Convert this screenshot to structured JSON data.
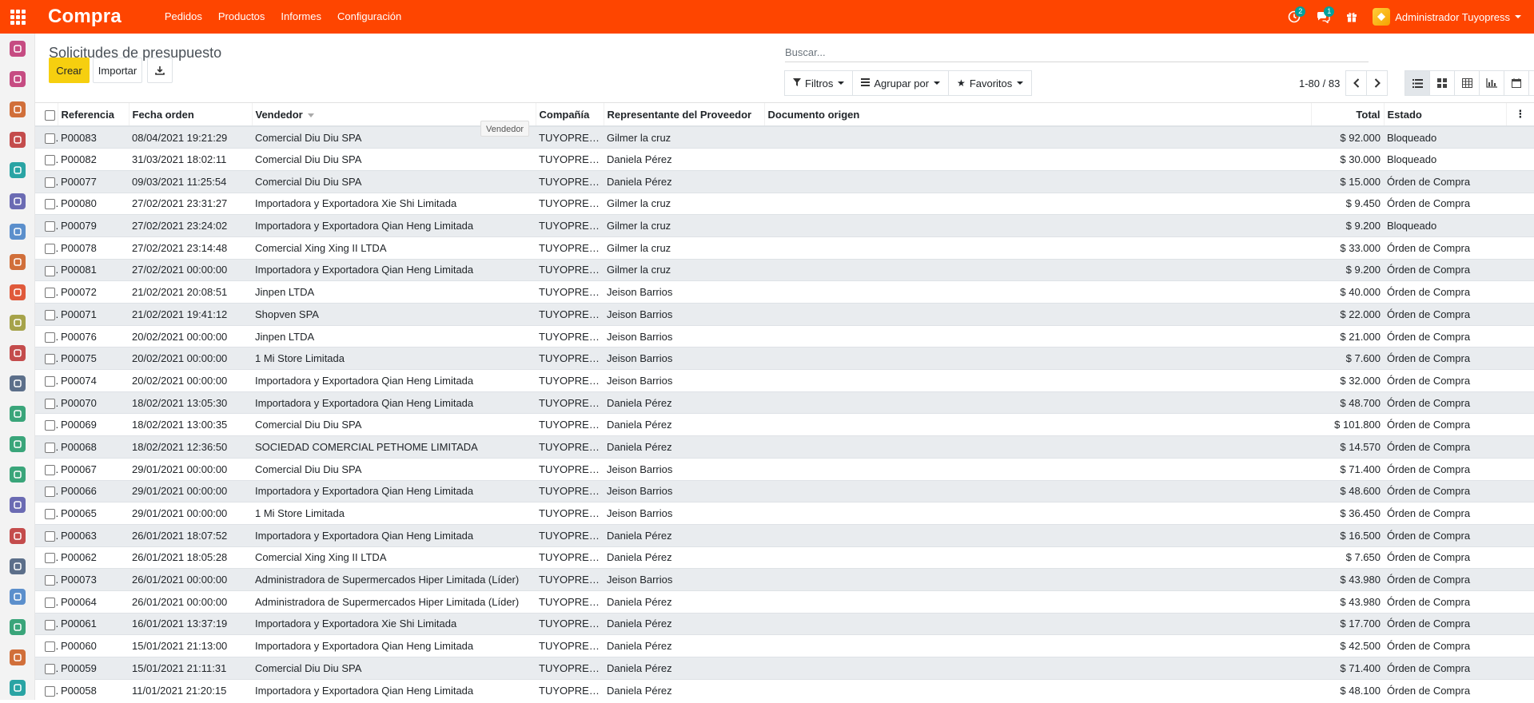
{
  "navbar": {
    "brand": "Compra",
    "menu": [
      "Pedidos",
      "Productos",
      "Informes",
      "Configuración"
    ],
    "activity_badge": "2",
    "messages_badge": "1",
    "user": "Administrador Tuyopress",
    "color": "#fe4500"
  },
  "sidebar": {
    "icons": [
      {
        "name": "discuss-icon",
        "color": "#c64c82"
      },
      {
        "name": "calendar-icon",
        "color": "#c64c82"
      },
      {
        "name": "crm-icon",
        "color": "#d16f3a"
      },
      {
        "name": "sales-icon",
        "color": "#c44c4c"
      },
      {
        "name": "contacts-icon",
        "color": "#2aa4a4"
      },
      {
        "name": "documents-icon",
        "color": "#6b6bb3"
      },
      {
        "name": "accounting-icon",
        "color": "#5b8fcc"
      },
      {
        "name": "expenses-icon",
        "color": "#d16f3a"
      },
      {
        "name": "website-icon",
        "color": "#e05a3b"
      },
      {
        "name": "events-icon",
        "color": "#a6a34a"
      },
      {
        "name": "livechat-icon",
        "color": "#c44c4c"
      },
      {
        "name": "pos-icon",
        "color": "#5c6f8a"
      },
      {
        "name": "employees-icon",
        "color": "#3aa57a"
      },
      {
        "name": "maintenance-icon",
        "color": "#3aa57a"
      },
      {
        "name": "fleet-icon",
        "color": "#3aa57a"
      },
      {
        "name": "apps-icon",
        "color": "#6b6bb3"
      },
      {
        "name": "timesheets-icon",
        "color": "#c44c4c"
      },
      {
        "name": "email-marketing-icon",
        "color": "#5c6f8a"
      },
      {
        "name": "mobile-icon",
        "color": "#5b8fcc"
      },
      {
        "name": "tags-icon",
        "color": "#3aa57a"
      },
      {
        "name": "notes-icon",
        "color": "#d16f3a"
      },
      {
        "name": "team-icon",
        "color": "#2aa4a4"
      }
    ]
  },
  "control_panel": {
    "title": "Solicitudes de presupuesto",
    "search_placeholder": "Buscar...",
    "create_label": "Crear",
    "import_label": "Importar",
    "filters_label": "Filtros",
    "groupby_label": "Agrupar por",
    "favorites_label": "Favoritos",
    "pager_value": "1-80 / 83"
  },
  "tooltip": "Vendedor",
  "table": {
    "columns": [
      "Referencia",
      "Fecha orden",
      "Vendedor",
      "Compañía",
      "Representante del Proveedor",
      "Documento origen",
      "Total",
      "Estado"
    ],
    "rows": [
      [
        "P00083",
        "08/04/2021 19:21:29",
        "Comercial Diu Diu SPA",
        "TUYOPRESS",
        "Gilmer la cruz",
        "",
        "$ 92.000",
        "Bloqueado"
      ],
      [
        "P00082",
        "31/03/2021 18:02:11",
        "Comercial Diu Diu SPA",
        "TUYOPRESS",
        "Daniela Pérez",
        "",
        "$ 30.000",
        "Bloqueado"
      ],
      [
        "P00077",
        "09/03/2021 11:25:54",
        "Comercial Diu Diu SPA",
        "TUYOPRESS",
        "Daniela Pérez",
        "",
        "$ 15.000",
        "Órden de Compra"
      ],
      [
        "P00080",
        "27/02/2021 23:31:27",
        "Importadora y Exportadora Xie Shi Limitada",
        "TUYOPRESS",
        "Gilmer la cruz",
        "",
        "$ 9.450",
        "Órden de Compra"
      ],
      [
        "P00079",
        "27/02/2021 23:24:02",
        "Importadora y Exportadora Qian Heng Limitada",
        "TUYOPRESS",
        "Gilmer la cruz",
        "",
        "$ 9.200",
        "Bloqueado"
      ],
      [
        "P00078",
        "27/02/2021 23:14:48",
        "Comercial Xing Xing II LTDA",
        "TUYOPRESS",
        "Gilmer la cruz",
        "",
        "$ 33.000",
        "Órden de Compra"
      ],
      [
        "P00081",
        "27/02/2021 00:00:00",
        "Importadora y Exportadora Qian Heng Limitada",
        "TUYOPRESS",
        "Gilmer la cruz",
        "",
        "$ 9.200",
        "Órden de Compra"
      ],
      [
        "P00072",
        "21/02/2021 20:08:51",
        "Jinpen LTDA",
        "TUYOPRESS",
        "Jeison Barrios",
        "",
        "$ 40.000",
        "Órden de Compra"
      ],
      [
        "P00071",
        "21/02/2021 19:41:12",
        "Shopven SPA",
        "TUYOPRESS",
        "Jeison Barrios",
        "",
        "$ 22.000",
        "Órden de Compra"
      ],
      [
        "P00076",
        "20/02/2021 00:00:00",
        "Jinpen LTDA",
        "TUYOPRESS",
        "Jeison Barrios",
        "",
        "$ 21.000",
        "Órden de Compra"
      ],
      [
        "P00075",
        "20/02/2021 00:00:00",
        "1 Mi Store Limitada",
        "TUYOPRESS",
        "Jeison Barrios",
        "",
        "$ 7.600",
        "Órden de Compra"
      ],
      [
        "P00074",
        "20/02/2021 00:00:00",
        "Importadora y Exportadora Qian Heng Limitada",
        "TUYOPRESS",
        "Jeison Barrios",
        "",
        "$ 32.000",
        "Órden de Compra"
      ],
      [
        "P00070",
        "18/02/2021 13:05:30",
        "Importadora y Exportadora Qian Heng Limitada",
        "TUYOPRESS",
        "Daniela Pérez",
        "",
        "$ 48.700",
        "Órden de Compra"
      ],
      [
        "P00069",
        "18/02/2021 13:00:35",
        "Comercial Diu Diu SPA",
        "TUYOPRESS",
        "Daniela Pérez",
        "",
        "$ 101.800",
        "Órden de Compra"
      ],
      [
        "P00068",
        "18/02/2021 12:36:50",
        "SOCIEDAD COMERCIAL PETHOME LIMITADA",
        "TUYOPRESS",
        "Daniela Pérez",
        "",
        "$ 14.570",
        "Órden de Compra"
      ],
      [
        "P00067",
        "29/01/2021 00:00:00",
        "Comercial Diu Diu SPA",
        "TUYOPRESS",
        "Jeison Barrios",
        "",
        "$ 71.400",
        "Órden de Compra"
      ],
      [
        "P00066",
        "29/01/2021 00:00:00",
        "Importadora y Exportadora Qian Heng Limitada",
        "TUYOPRESS",
        "Jeison Barrios",
        "",
        "$ 48.600",
        "Órden de Compra"
      ],
      [
        "P00065",
        "29/01/2021 00:00:00",
        "1 Mi Store Limitada",
        "TUYOPRESS",
        "Jeison Barrios",
        "",
        "$ 36.450",
        "Órden de Compra"
      ],
      [
        "P00063",
        "26/01/2021 18:07:52",
        "Importadora y Exportadora Qian Heng Limitada",
        "TUYOPRESS",
        "Daniela Pérez",
        "",
        "$ 16.500",
        "Órden de Compra"
      ],
      [
        "P00062",
        "26/01/2021 18:05:28",
        "Comercial Xing Xing II LTDA",
        "TUYOPRESS",
        "Daniela Pérez",
        "",
        "$ 7.650",
        "Órden de Compra"
      ],
      [
        "P00073",
        "26/01/2021 00:00:00",
        "Administradora de Supermercados Hiper Limitada (Líder)",
        "TUYOPRESS",
        "Jeison Barrios",
        "",
        "$ 43.980",
        "Órden de Compra"
      ],
      [
        "P00064",
        "26/01/2021 00:00:00",
        "Administradora de Supermercados Hiper Limitada (Líder)",
        "TUYOPRESS",
        "Daniela Pérez",
        "",
        "$ 43.980",
        "Órden de Compra"
      ],
      [
        "P00061",
        "16/01/2021 13:37:19",
        "Importadora y Exportadora Xie Shi Limitada",
        "TUYOPRESS",
        "Daniela Pérez",
        "",
        "$ 17.700",
        "Órden de Compra"
      ],
      [
        "P00060",
        "15/01/2021 21:13:00",
        "Importadora y Exportadora Qian Heng Limitada",
        "TUYOPRESS",
        "Daniela Pérez",
        "",
        "$ 42.500",
        "Órden de Compra"
      ],
      [
        "P00059",
        "15/01/2021 21:11:31",
        "Comercial Diu Diu SPA",
        "TUYOPRESS",
        "Daniela Pérez",
        "",
        "$ 71.400",
        "Órden de Compra"
      ],
      [
        "P00058",
        "11/01/2021 21:20:15",
        "Importadora y Exportadora Qian Heng Limitada",
        "TUYOPRESS",
        "Daniela Pérez",
        "",
        "$ 48.100",
        "Órden de Compra"
      ]
    ]
  }
}
